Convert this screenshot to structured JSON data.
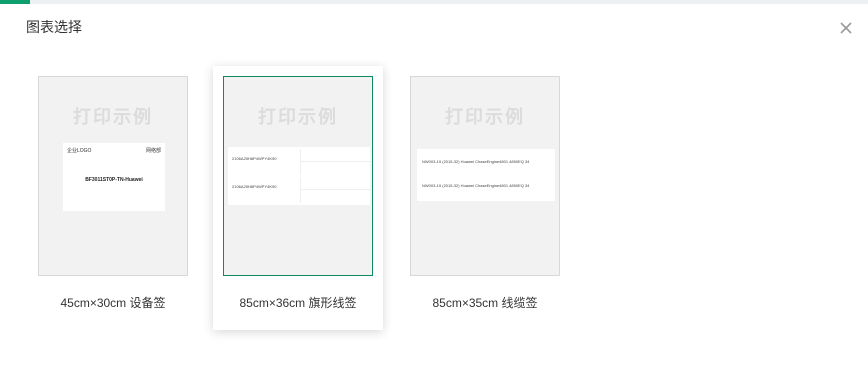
{
  "dialog": {
    "title": "图表选择"
  },
  "watermark": "打印示例",
  "cards": [
    {
      "caption": "45cm×30cm 设备签",
      "selected": false,
      "sample": {
        "logo": "企业LOGO",
        "network": "网络部",
        "code": "BF3011ST0P-TN-Huawei"
      }
    },
    {
      "caption": "85cm×36cm 旗形线签",
      "selected": true,
      "sample": {
        "row1": "2106A25H8P4WPY4K90",
        "row2": "2106A25H8P4WPY4K90"
      }
    },
    {
      "caption": "85cm×35cm 线缆签",
      "selected": false,
      "sample": {
        "line1": "NW003-19 (2015-32) Huawei ChaseEngine4801 4850EQ 34",
        "line2": "NW003-19 (2015-32) Huawei ChaseEngine4801 4850EQ 34"
      }
    }
  ],
  "colors": {
    "accent": "#0e8a5f",
    "preview_bg": "#f2f2f2",
    "watermark": "#dcdcdc"
  }
}
